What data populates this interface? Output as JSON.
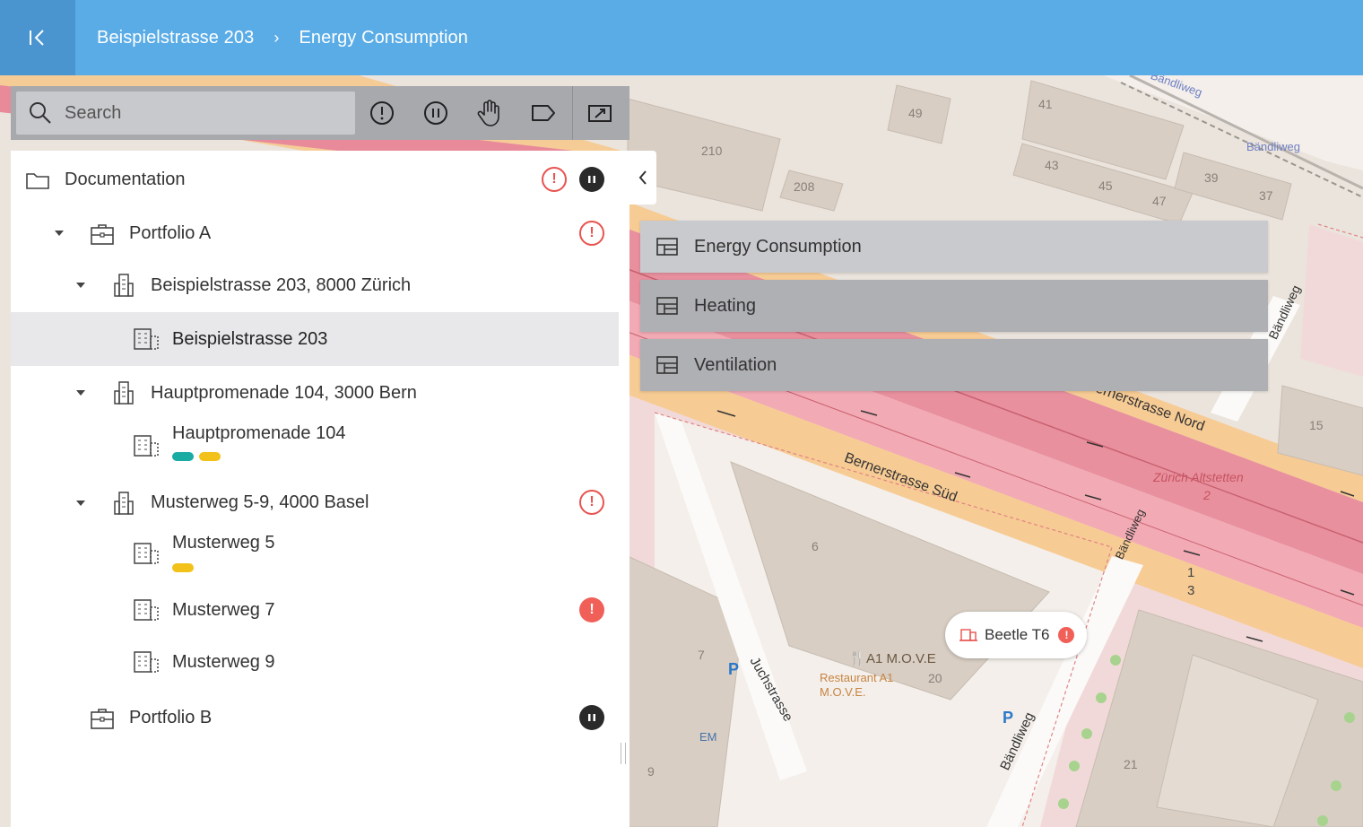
{
  "header": {
    "breadcrumb": [
      "Beispielstrasse 203",
      "Energy Consumption"
    ],
    "separator": "›",
    "background": "#5aace6"
  },
  "toolbar": {
    "search_placeholder": "Search",
    "filters": [
      "alert-icon",
      "pause-icon",
      "hand-icon",
      "tag-icon",
      "edit-view-icon"
    ]
  },
  "tree": {
    "root": {
      "label": "Documentation",
      "badges": [
        "warning",
        "paused"
      ]
    },
    "items": [
      {
        "label": "Portfolio A",
        "level": 1,
        "kind": "portfolio",
        "expanded": true,
        "badge": "warning"
      },
      {
        "label": "Beispielstrasse 203, 8000 Zürich",
        "level": 2,
        "kind": "site",
        "expanded": true
      },
      {
        "label": "Beispielstrasse 203",
        "level": 3,
        "kind": "building",
        "selected": true
      },
      {
        "label": "Hauptpromenade 104, 3000 Bern",
        "level": 2,
        "kind": "site",
        "expanded": true
      },
      {
        "label": "Hauptpromenade 104",
        "level": 3,
        "kind": "building",
        "tags": [
          "#1aaba3",
          "#f2c21b"
        ]
      },
      {
        "label": "Musterweg 5-9, 4000 Basel",
        "level": 2,
        "kind": "site",
        "expanded": true,
        "badge": "warning"
      },
      {
        "label": "Musterweg 5",
        "level": 3,
        "kind": "building",
        "tags": [
          "#f2c21b"
        ]
      },
      {
        "label": "Musterweg 7",
        "level": 3,
        "kind": "building",
        "badge": "error"
      },
      {
        "label": "Musterweg 9",
        "level": 3,
        "kind": "building"
      },
      {
        "label": "Portfolio B",
        "level": 1,
        "kind": "portfolio",
        "badge": "paused"
      }
    ]
  },
  "layers": [
    {
      "label": "Energy Consumption",
      "active": true
    },
    {
      "label": "Heating",
      "active": false
    },
    {
      "label": "Ventilation",
      "active": false
    }
  ],
  "marker": {
    "label": "Beetle T6",
    "badge": "error"
  },
  "map_labels": {
    "streets": [
      "Bernerstrasse Süd",
      "Bernerstrasse Nord",
      "Bändliweg",
      "Juchstrasse",
      "Zürich Altstetten"
    ],
    "numbers": [
      "210",
      "208",
      "49",
      "41",
      "43",
      "45",
      "47",
      "39",
      "37",
      "15",
      "6",
      "7",
      "9",
      "20",
      "21"
    ],
    "pois": [
      "A1 M.O.V.E",
      "Restaurant A1 M.O.V.E.",
      "EM",
      "Bändliweg"
    ],
    "track_numbers": [
      "1",
      "3"
    ],
    "platform": "2"
  },
  "colors": {
    "warning": "#e8534f",
    "paused": "#2a2a2a",
    "selected_row": "#e8e8ea",
    "layer_active": "#c9cacd",
    "layer_inactive": "#afb0b4"
  }
}
